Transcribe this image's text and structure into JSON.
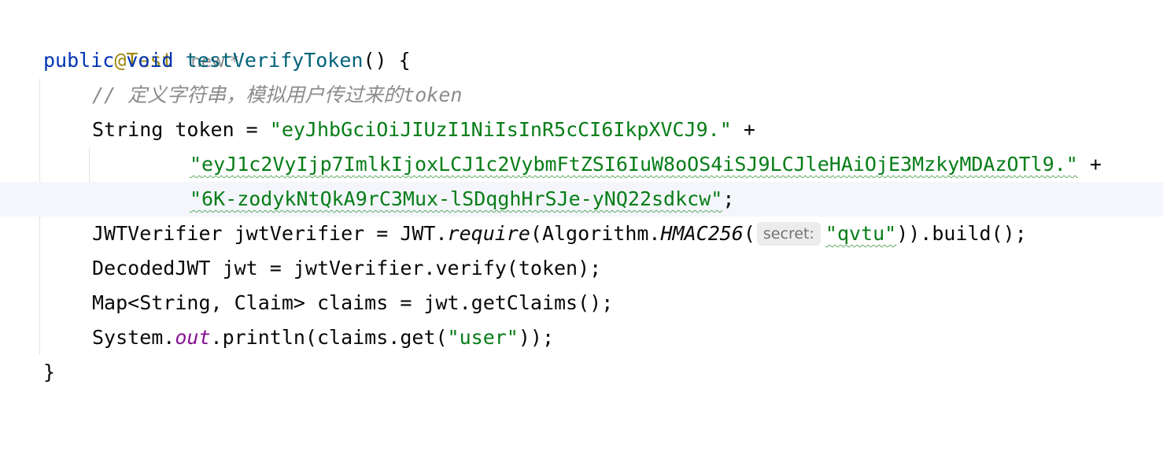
{
  "annotation": "@Test",
  "author_hint": "new *",
  "method": {
    "kw_public": "public",
    "kw_void": "void",
    "name": "testVerifyToken",
    "signature_tail": "() {"
  },
  "comment": {
    "slashes": "// ",
    "text": "定义字符串，模拟用户传过来的",
    "tail": "token"
  },
  "token_decl": {
    "prefix": "String token = ",
    "str1": "\"eyJhbGciOiJIUzI1NiIsInR5cCI6IkpXVCJ9.\"",
    "plus": " +"
  },
  "token_cont1": {
    "str": "\"eyJ1c2VyIjp7ImlkIjoxLCJ1c2VybmFtZSI6IuW8oOS4iSJ9LCJleHAiOjE3MzkyMDAzOTl9.\"",
    "plus": " +"
  },
  "token_cont2": {
    "str": "\"6K-zodykNtQkA9rC3Mux-lSDqghHrSJe-yNQ22sdkcw\"",
    "end": ";"
  },
  "verifier": {
    "prefix": "JWTVerifier jwtVerifier = JWT.",
    "require": "require",
    "mid": "(Algorithm.",
    "hmac": "HMAC256",
    "open": "(",
    "param_hint": "secret:",
    "secret": "\"qvtu\"",
    "tail": ")).build();"
  },
  "decode_line": "DecodedJWT jwt = jwtVerifier.verify(token);",
  "claims_line": "Map<String, Claim> claims = jwt.getClaims();",
  "print": {
    "prefix": "System.",
    "out": "out",
    "mid": ".println(claims.get(",
    "str": "\"user\"",
    "tail": "));"
  },
  "close_brace": "}",
  "colors": {
    "keyword": "#0033b3",
    "method": "#00627a",
    "annotation": "#9e880d",
    "string": "#067d17",
    "comment": "#8c8c8c",
    "static_field": "#871094",
    "current_line": "#f4f6fb"
  }
}
